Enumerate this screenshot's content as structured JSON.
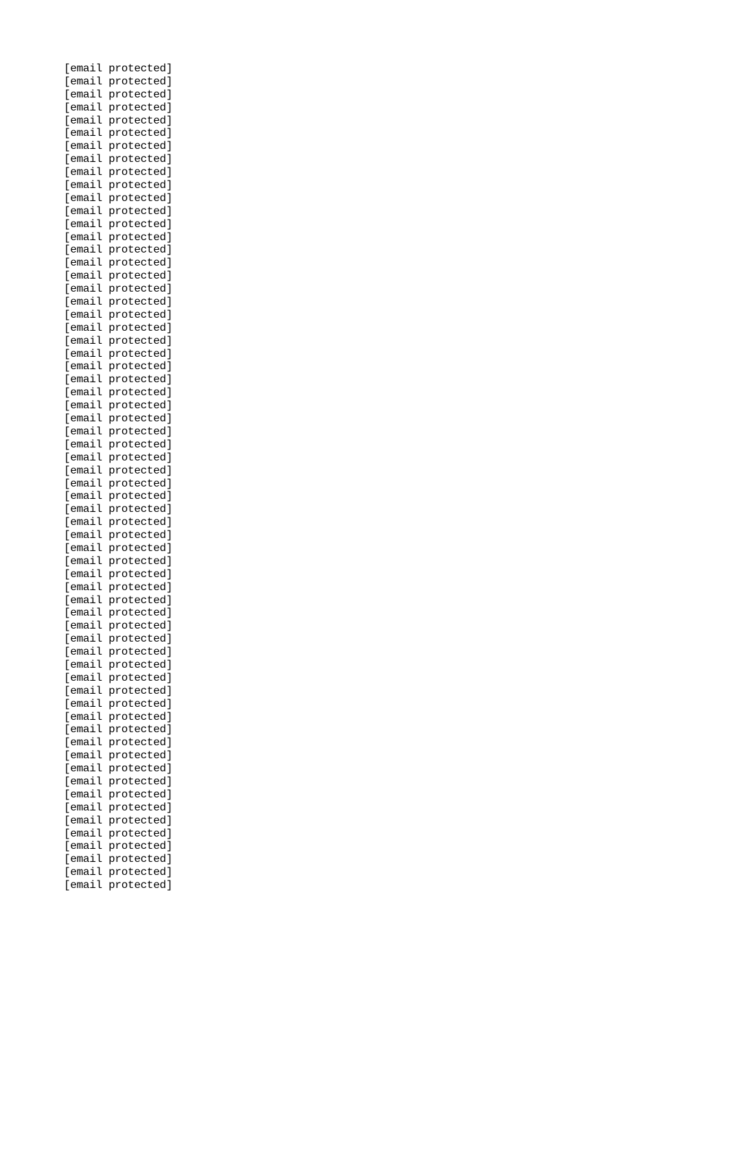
{
  "document": {
    "lines": [
      "[email protected]",
      "[email protected]",
      "[email protected]",
      "[email protected]",
      "[email protected]",
      "[email protected]",
      "[email protected]",
      "[email protected]",
      "[email protected]",
      "[email protected]",
      "[email protected]",
      "[email protected]",
      "[email protected]",
      "[email protected]",
      "[email protected]",
      "[email protected]",
      "[email protected]",
      "[email protected]",
      "[email protected]",
      "[email protected]",
      "[email protected]",
      "[email protected]",
      "[email protected]",
      "[email protected]",
      "[email protected]",
      "[email protected]",
      "[email protected]",
      "[email protected]",
      "[email protected]",
      "[email protected]",
      "[email protected]",
      "[email protected]",
      "[email protected]",
      "[email protected]",
      "[email protected]",
      "[email protected]",
      "[email protected]",
      "[email protected]",
      "[email protected]",
      "[email protected]",
      "[email protected]",
      "[email protected]",
      "[email protected]",
      "[email protected]",
      "[email protected]",
      "[email protected]",
      "[email protected]",
      "[email protected]",
      "[email protected]",
      "[email protected]",
      "[email protected]",
      "[email protected]",
      "[email protected]",
      "[email protected]",
      "[email protected]",
      "[email protected]",
      "[email protected]",
      "[email protected]",
      "[email protected]",
      "[email protected]",
      "[email protected]",
      "[email protected]",
      "[email protected]",
      "[email protected]"
    ]
  }
}
